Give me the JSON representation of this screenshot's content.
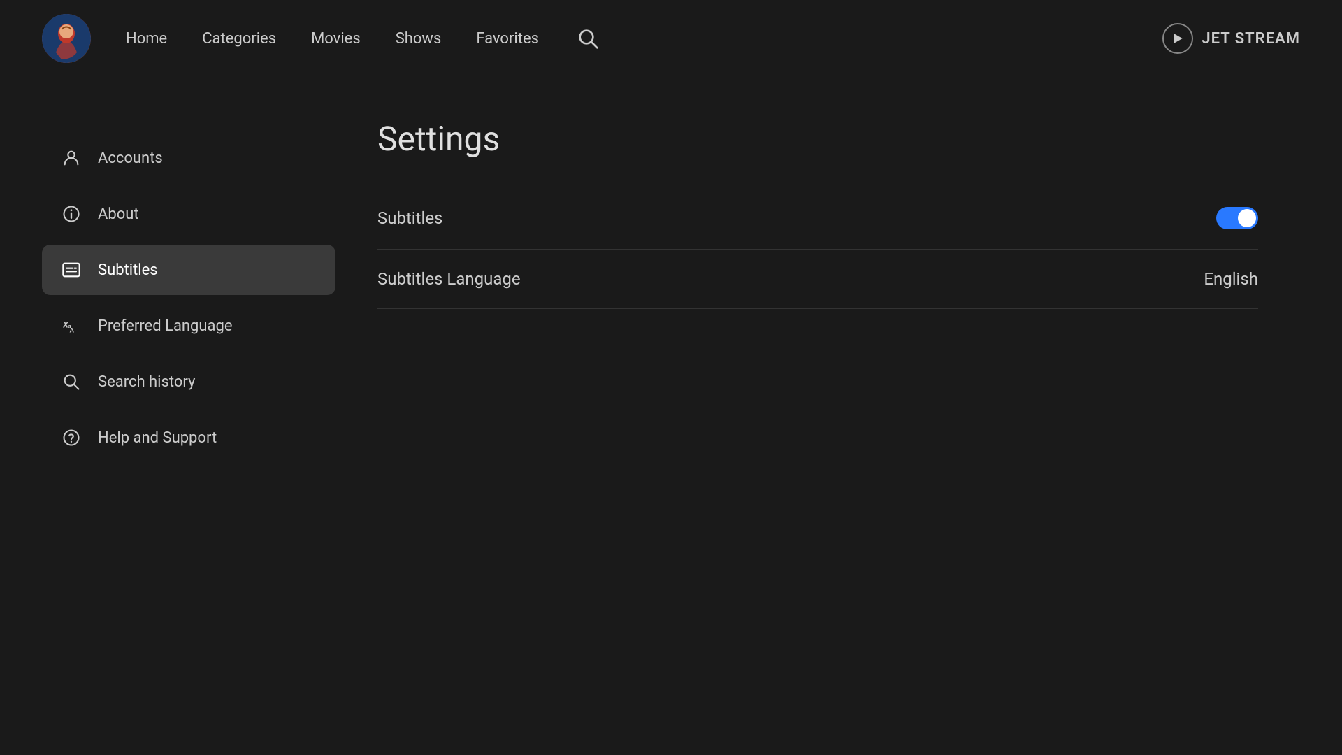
{
  "header": {
    "nav": {
      "home": "Home",
      "categories": "Categories",
      "movies": "Movies",
      "shows": "Shows",
      "favorites": "Favorites"
    },
    "brand": "JET STREAM"
  },
  "settings": {
    "title": "Settings",
    "rows": [
      {
        "id": "subtitles-toggle",
        "label": "Subtitles",
        "type": "toggle",
        "value": true
      },
      {
        "id": "subtitles-language",
        "label": "Subtitles Language",
        "type": "value",
        "value": "English"
      }
    ]
  },
  "sidebar": {
    "items": [
      {
        "id": "accounts",
        "label": "Accounts",
        "icon": "person"
      },
      {
        "id": "about",
        "label": "About",
        "icon": "info"
      },
      {
        "id": "subtitles",
        "label": "Subtitles",
        "icon": "subtitles",
        "active": true
      },
      {
        "id": "preferred-language",
        "label": "Preferred Language",
        "icon": "language"
      },
      {
        "id": "search-history",
        "label": "Search history",
        "icon": "search"
      },
      {
        "id": "help-support",
        "label": "Help and Support",
        "icon": "help"
      }
    ]
  }
}
